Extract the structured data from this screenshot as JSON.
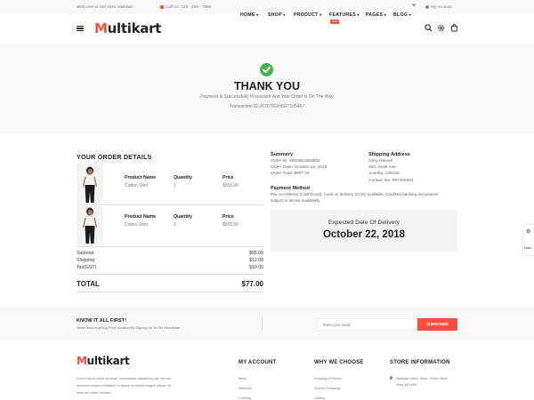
{
  "topbar": {
    "welcome": "Welcome to Our store Multikart",
    "call": "Call Us: 123 - 456 - 7890",
    "account": "My Account"
  },
  "header": {
    "logo_m": "M",
    "logo_rest": "ultikart",
    "nav": [
      "HOME",
      "SHOP",
      "PRODUCT",
      "FEATURES",
      "PAGES",
      "BLOG"
    ],
    "new_badge": "new"
  },
  "thanks": {
    "title": "THANK YOU",
    "message": "Payment Is Successfully Processed And Your Order Is On The Way",
    "transaction": "Transaction ID:267676GHERT105467"
  },
  "order": {
    "title": "YOUR ORDER DETAILS",
    "col_name": "Product Name",
    "col_qty": "Quantity",
    "col_price": "Price",
    "items": [
      {
        "name": "Cotton Shirt",
        "qty": "1",
        "price": "$555.00"
      },
      {
        "name": "Cotton Shirt",
        "qty": "1",
        "price": "$555.00"
      }
    ],
    "subtotal_label": "Subtotal",
    "subtotal": "$55.00",
    "shipping_label": "Shipping",
    "shipping": "$12.00",
    "tax_label": "Tax(GST)",
    "tax": "$10.00",
    "total_label": "TOTAL",
    "total": "$77.00"
  },
  "summary": {
    "title": "Summery",
    "order_id": "Order ID: 5563853658932",
    "order_date": "Order Date: October 22, 2018",
    "order_total": "Order Total: $907.28"
  },
  "shipping_address": {
    "title": "Shipping Address",
    "lines": [
      "Gerg Harvell",
      "568, Suite Ave.",
      "Austrlia, 235153",
      "Contact No. 987456321"
    ]
  },
  "payment": {
    "title": "Payment Method",
    "text1": "Pay on Delivery (Cash/Card). Cash on delivery (COD) available. Card/Net banking acceptance",
    "text2": "subject to device availability."
  },
  "delivery": {
    "label": "Expected Date Of Delivery",
    "date": "October 22, 2018"
  },
  "side_widget": {
    "dark": "Dark"
  },
  "newsletter": {
    "title": "KNOW IT ALL FIRST!",
    "subtitle": "Never Miss Anything From Multikart By Signing Up To Our Newsletter.",
    "placeholder": "Enter your email",
    "button": "SUBSCRIBE"
  },
  "footer": {
    "about1": "Lorem ipsum dolor sit amet, consectetur adipisicing elit, sed do",
    "about2": "eiusmod tempor incididunt ut labore et dolore magna aliqua. Ut",
    "about3": "enim ad minim veniam,",
    "my_account": {
      "title": "MY ACCOUNT",
      "links": [
        "Mens",
        "Womens",
        "Clothing"
      ]
    },
    "why": {
      "title": "WHY WE CHOOSE",
      "links": [
        "Shipping & Return",
        "Secure Shopping",
        "Gallery"
      ]
    },
    "store": {
      "title": "STORE INFORMATION",
      "address1": "Multikart Demo Store, Demo Store",
      "address2": "India 345-659"
    }
  }
}
